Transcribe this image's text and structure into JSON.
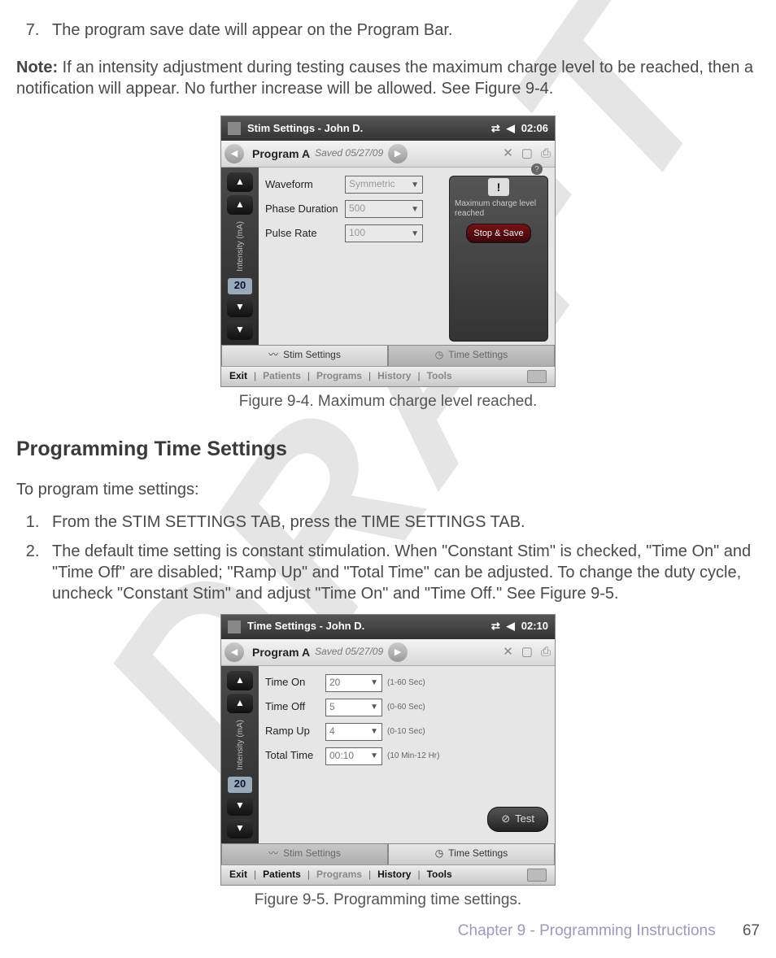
{
  "step7": "The program save date will appear on the Program Bar.",
  "note_label": "Note:",
  "note_text": " If an intensity adjustment during testing causes the maximum charge level to be reached, then a notification will appear. No further increase will be allowed. See Figure 9-4.",
  "fig94": {
    "title": "Stim Settings - John D.",
    "time": "02:06",
    "program": "Program A",
    "saved": "Saved 05/27/09",
    "intensity_label": "Intensity (mA)",
    "intensity_value": "20",
    "params": [
      {
        "label": "Waveform",
        "value": "Symmetric"
      },
      {
        "label": "Phase Duration",
        "value": "500"
      },
      {
        "label": "Pulse Rate",
        "value": "100"
      }
    ],
    "alert_text": "Maximum charge level reached",
    "alert_btn": "Stop & Save",
    "tab_stim": "Stim Settings",
    "tab_time": "Time Settings",
    "nav": {
      "exit": "Exit",
      "patients": "Patients",
      "programs": "Programs",
      "history": "History",
      "tools": "Tools"
    },
    "caption": "Figure 9-4. Maximum charge level reached."
  },
  "section_heading": "Programming Time Settings",
  "intro_line": "To program time settings:",
  "steps": {
    "s1": "From the STIM SETTINGS TAB, press the TIME SETTINGS TAB.",
    "s2": "The default time setting is constant stimulation. When \"Constant Stim\" is checked, \"Time On\" and \"Time Off\" are disabled; \"Ramp Up\" and \"Total Time\" can be adjusted. To change the duty cycle, uncheck \"Constant Stim\" and adjust \"Time On\" and \"Time Off.\" See Figure 9-5."
  },
  "fig95": {
    "title": "Time Settings - John D.",
    "time": "02:10",
    "program": "Program A",
    "saved": "Saved 05/27/09",
    "intensity_label": "Intensity (mA)",
    "intensity_value": "20",
    "params": [
      {
        "label": "Time On",
        "value": "20",
        "hint": "(1-60 Sec)"
      },
      {
        "label": "Time Off",
        "value": "5",
        "hint": "(0-60 Sec)"
      },
      {
        "label": "Ramp Up",
        "value": "4",
        "hint": "(0-10 Sec)"
      },
      {
        "label": "Total Time",
        "value": "00:10",
        "hint": "(10 Min-12 Hr)"
      }
    ],
    "test_btn": "Test",
    "tab_stim": "Stim Settings",
    "tab_time": "Time Settings",
    "nav": {
      "exit": "Exit",
      "patients": "Patients",
      "programs": "Programs",
      "history": "History",
      "tools": "Tools"
    },
    "caption": "Figure 9-5. Programming time settings."
  },
  "footer": {
    "chapter": "Chapter 9 - Programming  Instructions",
    "page": "67"
  },
  "watermark": "DRAFT"
}
